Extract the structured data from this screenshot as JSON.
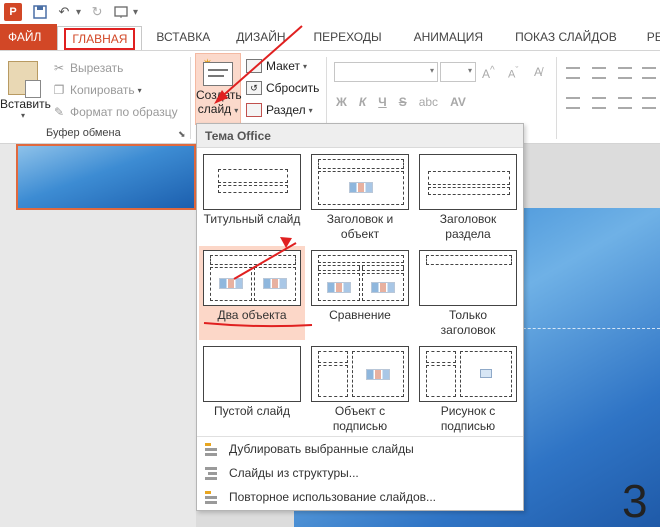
{
  "quick_access": {
    "app_icon": "powerpoint-icon",
    "app_letter": "P",
    "items": [
      "save-icon",
      "undo-icon",
      "redo-icon",
      "start-from-beginning-icon"
    ]
  },
  "tabs": [
    {
      "label": "ФАЙЛ"
    },
    {
      "label": "ГЛАВНАЯ"
    },
    {
      "label": "ВСТАВКА"
    },
    {
      "label": "ДИЗАЙН"
    },
    {
      "label": "ПЕРЕХОДЫ"
    },
    {
      "label": "АНИМАЦИЯ"
    },
    {
      "label": "ПОКАЗ СЛАЙДОВ"
    },
    {
      "label": "РЕЦЕ"
    }
  ],
  "clipboard": {
    "paste_label": "Вставить",
    "cut_label": "Вырезать",
    "copy_label": "Копировать",
    "format_painter_label": "Формат по образцу",
    "group_label": "Буфер обмена"
  },
  "slides_group": {
    "new_slide_line1": "Создать",
    "new_slide_line2": "слайд",
    "layout_label": "Макет",
    "reset_label": "Сбросить",
    "section_label": "Раздел"
  },
  "font_group": {
    "bold": "Ж",
    "italic": "К",
    "underline": "Ч",
    "strike": "S",
    "shadow": "abc",
    "spacing": "AV"
  },
  "gallery": {
    "header": "Тема Office",
    "layouts": [
      {
        "label": "Титульный слайд"
      },
      {
        "label": "Заголовок и объект"
      },
      {
        "label": "Заголовок раздела"
      },
      {
        "label": "Два объекта"
      },
      {
        "label": "Сравнение"
      },
      {
        "label": "Только заголовок"
      },
      {
        "label": "Пустой слайд"
      },
      {
        "label": "Объект с подписью"
      },
      {
        "label": "Рисунок с подписью"
      }
    ],
    "menu": [
      {
        "label": "Дублировать выбранные слайды",
        "icon": "duplicate-slides-icon"
      },
      {
        "label": "Слайды из структуры...",
        "icon": "slides-from-outline-icon"
      },
      {
        "label": "Повторное использование слайдов...",
        "icon": "reuse-slides-icon"
      }
    ]
  },
  "canvas": {
    "slide_number": "3"
  },
  "colors": {
    "accent": "#d24726",
    "annotation": "#e02020",
    "hover": "#fcd7c8"
  }
}
